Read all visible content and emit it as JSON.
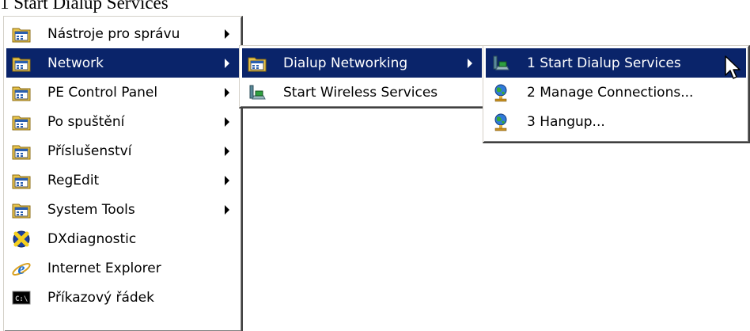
{
  "caption": "1 Start Dialup Services",
  "main_menu": [
    {
      "label": "Nástroje pro správu",
      "icon": "program-group-icon",
      "submenu": true
    },
    {
      "label": "Network",
      "icon": "program-group-icon",
      "submenu": true,
      "highlighted": true
    },
    {
      "label": "PE Control Panel",
      "icon": "program-group-icon",
      "submenu": true
    },
    {
      "label": "Po spuštění",
      "icon": "program-group-icon",
      "submenu": true
    },
    {
      "label": "Příslušenství",
      "icon": "program-group-icon",
      "submenu": true
    },
    {
      "label": "RegEdit",
      "icon": "program-group-icon",
      "submenu": true
    },
    {
      "label": "System Tools",
      "icon": "program-group-icon",
      "submenu": true
    },
    {
      "label": "DXdiagnostic",
      "icon": "dxdiag-icon",
      "submenu": false
    },
    {
      "label": "Internet Explorer",
      "icon": "internet-explorer-icon",
      "submenu": false
    },
    {
      "label": "Příkazový řádek",
      "icon": "command-prompt-icon",
      "submenu": false
    }
  ],
  "network_menu": [
    {
      "label": "Dialup Networking",
      "icon": "program-group-icon",
      "submenu": true,
      "highlighted": true
    },
    {
      "label": "Start Wireless Services",
      "icon": "network-connection-icon",
      "submenu": false
    }
  ],
  "dialup_menu": [
    {
      "label": "1 Start Dialup Services",
      "icon": "network-connection-icon",
      "submenu": false,
      "highlighted": true
    },
    {
      "label": "2 Manage Connections...",
      "icon": "globe-user-icon",
      "submenu": false
    },
    {
      "label": "3 Hangup...",
      "icon": "globe-user-icon",
      "submenu": false
    }
  ],
  "colors": {
    "highlight": "#0a246a",
    "highlight_text": "#ffffff",
    "menu_bg": "#ffffff"
  }
}
